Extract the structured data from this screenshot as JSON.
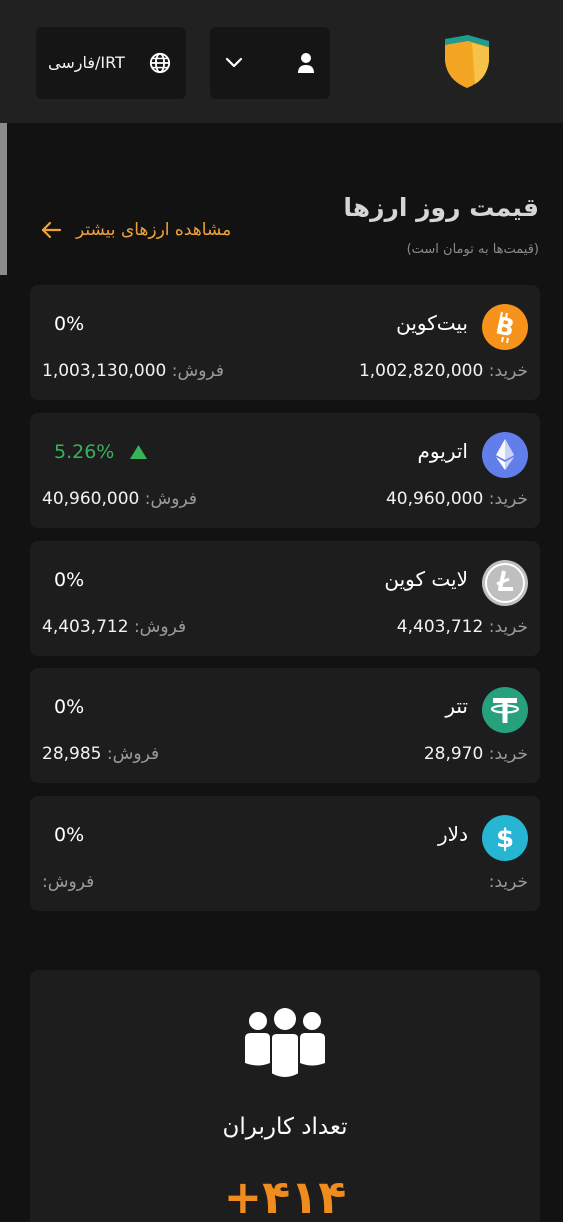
{
  "header": {
    "lang_currency": "فارسی/IRT",
    "icons": {
      "globe": "globe-icon",
      "chevron": "chevron-down-icon",
      "user": "user-icon",
      "logo": "shield-logo"
    }
  },
  "prices": {
    "title": "قیمت روز ارزها",
    "subtitle": "(قیمت‌ها به تومان است)",
    "more_link": "مشاهده ارزهای بیشتر"
  },
  "labels": {
    "buy": "خرید:",
    "sell": "فروش:"
  },
  "coins": [
    {
      "name": "بیت‌کوین",
      "icon": "bitcoin-icon",
      "color": "#f7931a",
      "change": "0%",
      "direction": "flat",
      "buy": "1,002,820,000",
      "sell": "1,003,130,000"
    },
    {
      "name": "اتریوم",
      "icon": "ethereum-icon",
      "color": "#627eea",
      "change": "5.26%",
      "direction": "up",
      "buy": "40,960,000",
      "sell": "40,960,000"
    },
    {
      "name": "لایت کوین",
      "icon": "litecoin-icon",
      "color": "#bfbfbf",
      "change": "0%",
      "direction": "flat",
      "buy": "4,403,712",
      "sell": "4,403,712"
    },
    {
      "name": "تتر",
      "icon": "tether-icon",
      "color": "#26a17b",
      "change": "0%",
      "direction": "flat",
      "buy": "28,970",
      "sell": "28,985"
    },
    {
      "name": "دلار",
      "icon": "dollar-icon",
      "color": "#26b6d4",
      "change": "0%",
      "direction": "flat",
      "buy": "",
      "sell": ""
    }
  ],
  "users": {
    "label": "تعداد کاربران",
    "count": "+۴۱۴",
    "icon": "users-group-icon"
  },
  "colors": {
    "accent": "#f0a23a",
    "positive": "#36b25b",
    "background": "#121212",
    "card": "#1d1d1d"
  }
}
